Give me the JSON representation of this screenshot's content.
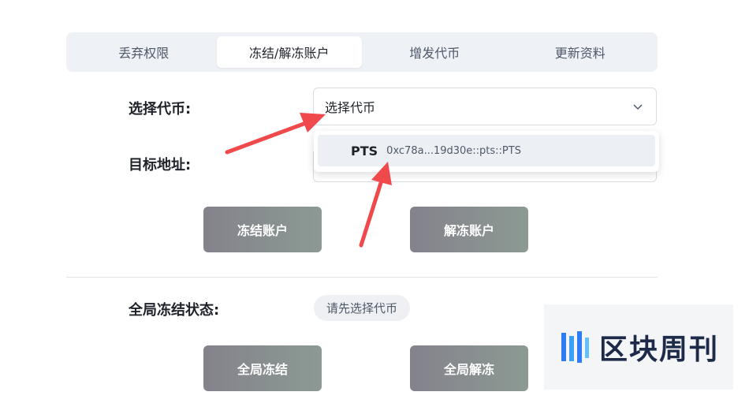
{
  "tabs": [
    {
      "label": "丢弃权限",
      "active": false
    },
    {
      "label": "冻结/解冻账户",
      "active": true
    },
    {
      "label": "增发代币",
      "active": false
    },
    {
      "label": "更新资料",
      "active": false
    }
  ],
  "form": {
    "token_label": "选择代币:",
    "token_placeholder": "选择代币",
    "address_label": "目标地址:"
  },
  "dropdown": {
    "options": [
      {
        "symbol": "PTS",
        "address": "0xc78a...19d30e::pts::PTS"
      }
    ]
  },
  "buttons": {
    "freeze": "冻结账户",
    "unfreeze": "解冻账户",
    "global_freeze": "全局冻结",
    "global_unfreeze": "全局解冻"
  },
  "global": {
    "status_label": "全局冻结状态:",
    "status_value": "请先选择代币"
  },
  "watermark": {
    "text": "区块周刊"
  },
  "colors": {
    "annotation_arrow": "#f0494b",
    "button_gradient_start": "#84828c",
    "button_gradient_end": "#8c9a93",
    "watermark_blue": "#2f7cf6"
  }
}
